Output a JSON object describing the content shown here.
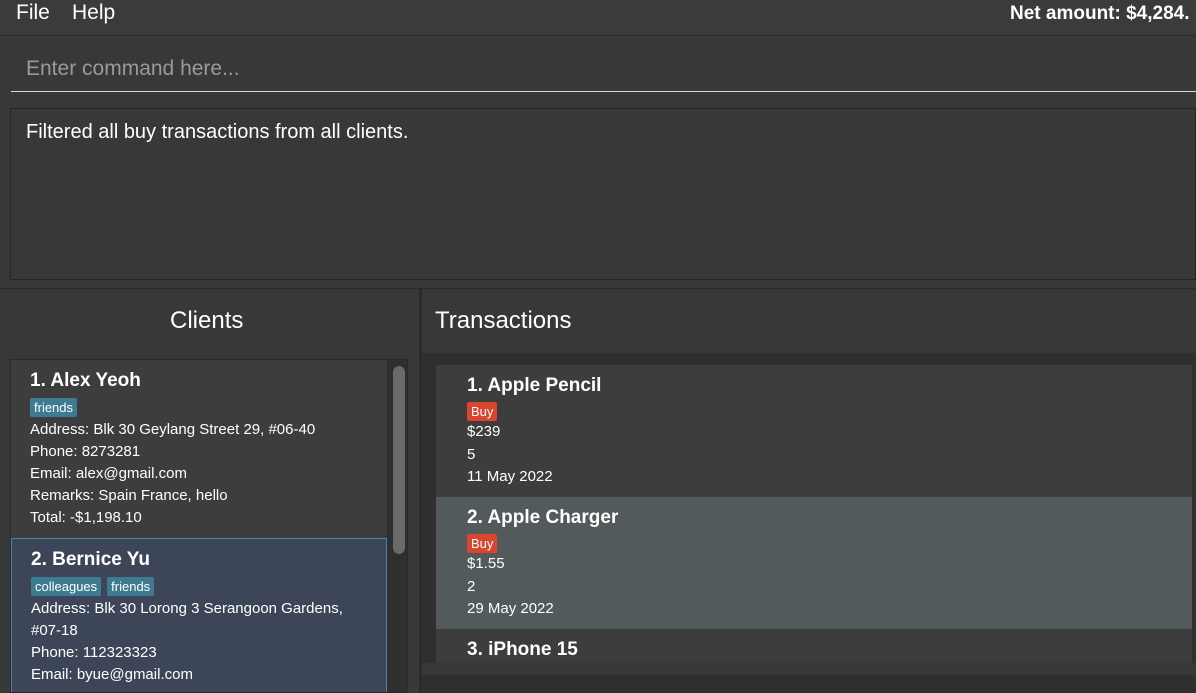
{
  "menu": {
    "file": "File",
    "help": "Help"
  },
  "net_amount": "Net amount: $4,284.",
  "command": {
    "placeholder": "Enter command here..."
  },
  "result": "Filtered all buy transactions from all clients.",
  "clients": {
    "title": "Clients",
    "items": [
      {
        "name": "1.  Alex Yeoh",
        "tags": [
          "friends"
        ],
        "address": "Address: Blk 30 Geylang Street 29, #06-40",
        "phone": "Phone: 8273281",
        "email": "Email: alex@gmail.com",
        "remarks": "Remarks: Spain France, hello",
        "total": "Total: -$1,198.10"
      },
      {
        "name": "2.  Bernice Yu",
        "tags": [
          "colleagues",
          "friends"
        ],
        "address": "Address: Blk 30 Lorong 3 Serangoon Gardens,",
        "address2": "#07-18",
        "phone": "Phone: 112323323",
        "email": "Email: byue@gmail.com"
      }
    ]
  },
  "transactions": {
    "title": "Transactions",
    "items": [
      {
        "name": "1.  Apple Pencil",
        "type": "Buy",
        "price": "$239",
        "qty": "5",
        "date": "11 May 2022"
      },
      {
        "name": "2.  Apple Charger",
        "type": "Buy",
        "price": "$1.55",
        "qty": "2",
        "date": "29 May 2022"
      },
      {
        "name": "3.  iPhone 15"
      }
    ]
  },
  "colors": {
    "background": "#2b2b2b",
    "tag": "#3e7b91",
    "buy_badge": "#d9452f",
    "selected_card": "#3c4658"
  }
}
